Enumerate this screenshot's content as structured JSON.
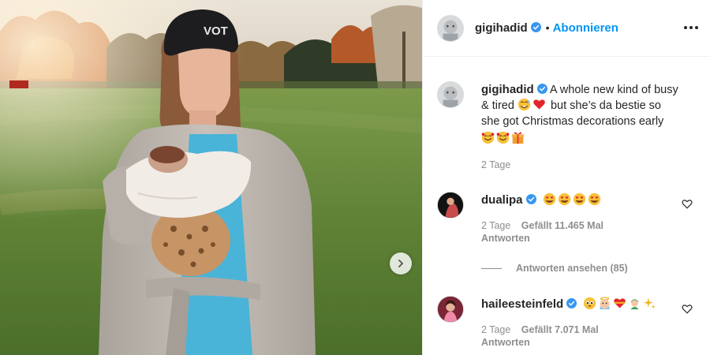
{
  "post": {
    "image_alt": "Photo of woman holding baby in autumn field",
    "beanie_text": "VOT"
  },
  "header": {
    "username": "gigihadid",
    "separator": "•",
    "follow_label": "Abonnieren",
    "more_icon": "more-horizontal-icon"
  },
  "caption": {
    "username": "gigihadid",
    "text_line1": "A whole new kind of busy",
    "text_line2_a": "& tired",
    "text_line2_b": "but she’s da bestie so",
    "text_line3": "she got Christmas decorations early",
    "emojis_line2": [
      "smiling-face-with-sweat-emoji",
      "red-heart-emoji"
    ],
    "emojis_line4": [
      "smiling-face-with-hearts-emoji",
      "smiling-face-with-hearts-emoji",
      "wrapped-gift-emoji"
    ],
    "time": "2 Tage"
  },
  "comments": [
    {
      "username": "dualipa",
      "emojis": [
        "heart-eyes-emoji",
        "heart-eyes-emoji",
        "heart-eyes-emoji",
        "heart-eyes-emoji"
      ],
      "time": "2 Tage",
      "likes": "Gefällt 11.465 Mal",
      "reply_label": "Antworten",
      "view_replies": "Antworten ansehen (85)"
    },
    {
      "username": "haileesteinfeld",
      "emojis": [
        "pleading-face-emoji",
        "baby-angel-emoji",
        "heart-with-ribbon-emoji",
        "mother-christmas-emoji",
        "sparkles-emoji"
      ],
      "time": "2 Tage",
      "likes": "Gefällt 7.071 Mal",
      "reply_label": "Antworten"
    }
  ],
  "colors": {
    "link_blue": "#0095f6",
    "verified_blue": "#3897f0",
    "muted": "#8e8e8e",
    "text": "#262626",
    "heart_red": "#ed4956"
  }
}
